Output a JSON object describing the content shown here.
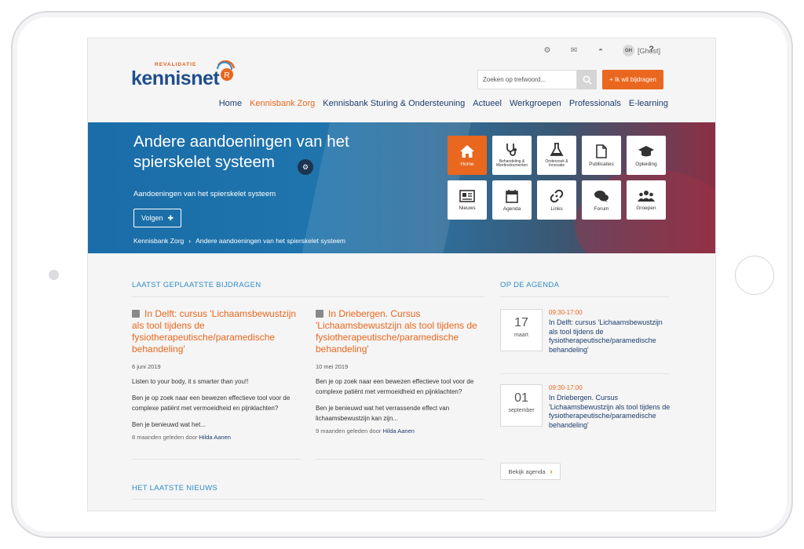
{
  "topbar": {
    "user_initials": "GH",
    "user_name": "[Ghost]",
    "help": "?"
  },
  "logo": {
    "small": "REVALIDATIE",
    "big": "kennisnet",
    "mark": "R"
  },
  "search": {
    "placeholder": "Zoeken op trefwoord..."
  },
  "contribute_label": "+ Ik wil bijdragen",
  "nav": [
    "Home",
    "Kennisbank Zorg",
    "Kennisbank Sturing & Ondersteuning",
    "Actueel",
    "Werkgroepen",
    "Professionals",
    "E-learning"
  ],
  "hero": {
    "title": "Andere aandoeningen van het spierskelet systeem",
    "subtitle": "Aandoeningen van het spierskelet systeem",
    "follow": "Volgen",
    "breadcrumb": [
      "Kennisbank Zorg",
      "Andere aandoeningen van het spierskelet systeem"
    ],
    "tiles": [
      {
        "label": "Home",
        "icon": "home-icon"
      },
      {
        "label": "Behandeling & Meetinstrumenten",
        "icon": "stethoscope-icon"
      },
      {
        "label": "Onderzoek & Innovatie",
        "icon": "flask-icon"
      },
      {
        "label": "Publicaties",
        "icon": "document-icon"
      },
      {
        "label": "Opleiding",
        "icon": "graduation-cap-icon"
      },
      {
        "label": "Nieuws",
        "icon": "newspaper-icon"
      },
      {
        "label": "Agenda",
        "icon": "calendar-icon"
      },
      {
        "label": "Links",
        "icon": "link-icon"
      },
      {
        "label": "Forum",
        "icon": "chat-icon"
      },
      {
        "label": "Groepen",
        "icon": "users-icon"
      }
    ]
  },
  "latest": {
    "heading": "LAATST GEPLAATSTE BIJDRAGEN",
    "posts": [
      {
        "title": "In Delft: cursus 'Lichaamsbewustzijn als tool tijdens de fysiotherapeutische/paramedische behandeling'",
        "date": "6 juni 2019",
        "paras": [
          "Listen to your body, it s smarter than you!!",
          "Ben je op zoek naar een bewezen effectieve tool voor de complexe patiënt met vermoeidheid en pijnklachten?",
          "Ben je benieuwd wat het..."
        ],
        "meta": "8 maanden geleden door",
        "author": "Hilda Aanen"
      },
      {
        "title": "In Driebergen. Cursus 'Lichaamsbewustzijn als tool tijdens de fysiotherapeutische/paramedische behandeling'",
        "date": "10 mei 2019",
        "paras": [
          "Ben je op zoek naar een bewezen effectieve tool voor de complexe patiënt met vermoeidheid en pijnklachten?",
          "Ben je benieuwd wat het verrassende effect van lichaamsbewustzijn kan zijn..."
        ],
        "meta": "9 maanden geleden door",
        "author": "Hilda Aanen"
      }
    ]
  },
  "news_heading": "HET LAATSTE NIEUWS",
  "agenda": {
    "heading": "OP DE AGENDA",
    "items": [
      {
        "day": "17",
        "month": "maart",
        "time": "09:30-17:00",
        "title": "In Delft: cursus 'Lichaamsbewustzijn als tool tijdens de fysiotherapeutische/paramedische behandeling'"
      },
      {
        "day": "01",
        "month": "september",
        "time": "09:30-17:00",
        "title": "In Driebergen. Cursus 'Lichaamsbewustzijn als tool tijdens de fysiotherapeutische/paramedische behandeling'"
      }
    ],
    "button": "Bekijk agenda"
  },
  "colors": {
    "accent": "#e9671e",
    "link": "#1b3d6d",
    "section": "#2d8bc9"
  }
}
